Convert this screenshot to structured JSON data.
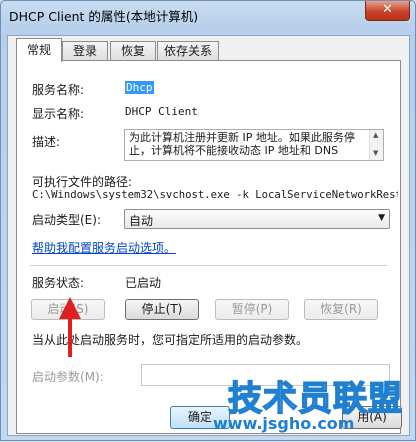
{
  "window": {
    "title": "DHCP Client 的属性(本地计算机)",
    "close_symbol": "✕"
  },
  "tabs": [
    {
      "label": "常规"
    },
    {
      "label": "登录"
    },
    {
      "label": "恢复"
    },
    {
      "label": "依存关系"
    }
  ],
  "general": {
    "service_name_label": "服务名称:",
    "service_name_value": "Dhcp",
    "display_name_label": "显示名称:",
    "display_name_value": "DHCP Client",
    "description_label": "描述:",
    "description_value": "为此计算机注册并更新 IP 地址。如果此服务停止，计算机将不能接收动态 IP 地址和 DNS",
    "exe_path_label": "可执行文件的路径:",
    "exe_path_value": "C:\\Windows\\system32\\svchost.exe -k LocalServiceNetworkRestri",
    "startup_type_label": "启动类型(E):",
    "startup_type_value": "自动",
    "help_link": "帮助我配置服务启动选项。",
    "service_status_label": "服务状态:",
    "service_status_value": "已启动",
    "buttons": {
      "start": "启动(S)",
      "stop": "停止(T)",
      "pause": "暂停(P)",
      "resume": "恢复(R)"
    },
    "hint": "当从此处启动服务时，您可指定所适用的启动参数。",
    "start_params_label": "启动参数(M):",
    "start_params_value": ""
  },
  "footer": {
    "ok_label": "确定",
    "apply_label": "用(A)"
  },
  "watermark": {
    "line1": "技术员联盟",
    "line2": "www.jsgho.com"
  }
}
